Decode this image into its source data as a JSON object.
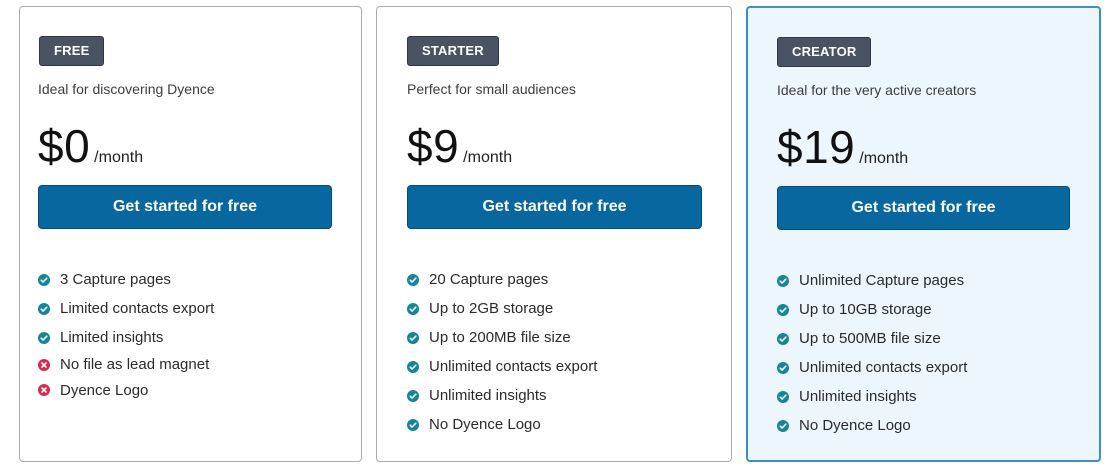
{
  "colors": {
    "check": "#13869a",
    "cross": "#d52b4f",
    "cta": "#08679e",
    "badge": "#4a5363",
    "featured_border": "#3a8fc8",
    "featured_bg": "#eef6fd"
  },
  "plans": [
    {
      "badge": "FREE",
      "tagline": "Ideal for discovering Dyence",
      "price": "$0",
      "period": "/month",
      "cta": "Get started for free",
      "features": [
        {
          "text": "3 Capture pages",
          "icon": "check-circle-icon"
        },
        {
          "text": "Limited contacts export",
          "icon": "check-circle-icon"
        },
        {
          "text": "Limited insights",
          "icon": "check-circle-icon"
        },
        {
          "text": "No file as lead magnet",
          "icon": "x-circle-icon"
        },
        {
          "text": "Dyence Logo",
          "icon": "x-circle-icon"
        }
      ]
    },
    {
      "badge": "STARTER",
      "tagline": "Perfect for small audiences",
      "price": "$9",
      "period": "/month",
      "cta": "Get started for free",
      "features": [
        {
          "text": "20 Capture pages",
          "icon": "check-circle-icon"
        },
        {
          "text": "Up to 2GB storage",
          "icon": "check-circle-icon"
        },
        {
          "text": "Up to 200MB file size",
          "icon": "check-circle-icon"
        },
        {
          "text": "Unlimited contacts export",
          "icon": "check-circle-icon"
        },
        {
          "text": "Unlimited insights",
          "icon": "check-circle-icon"
        },
        {
          "text": "No Dyence Logo",
          "icon": "check-circle-icon"
        }
      ]
    },
    {
      "badge": "CREATOR",
      "tagline": "Ideal for the very active creators",
      "price": "$19",
      "period": "/month",
      "cta": "Get started for free",
      "features": [
        {
          "text": "Unlimited Capture pages",
          "icon": "check-circle-icon"
        },
        {
          "text": "Up to 10GB storage",
          "icon": "check-circle-icon"
        },
        {
          "text": "Up to 500MB file size",
          "icon": "check-circle-icon"
        },
        {
          "text": "Unlimited contacts export",
          "icon": "check-circle-icon"
        },
        {
          "text": "Unlimited insights",
          "icon": "check-circle-icon"
        },
        {
          "text": "No Dyence Logo",
          "icon": "check-circle-icon"
        }
      ]
    }
  ]
}
